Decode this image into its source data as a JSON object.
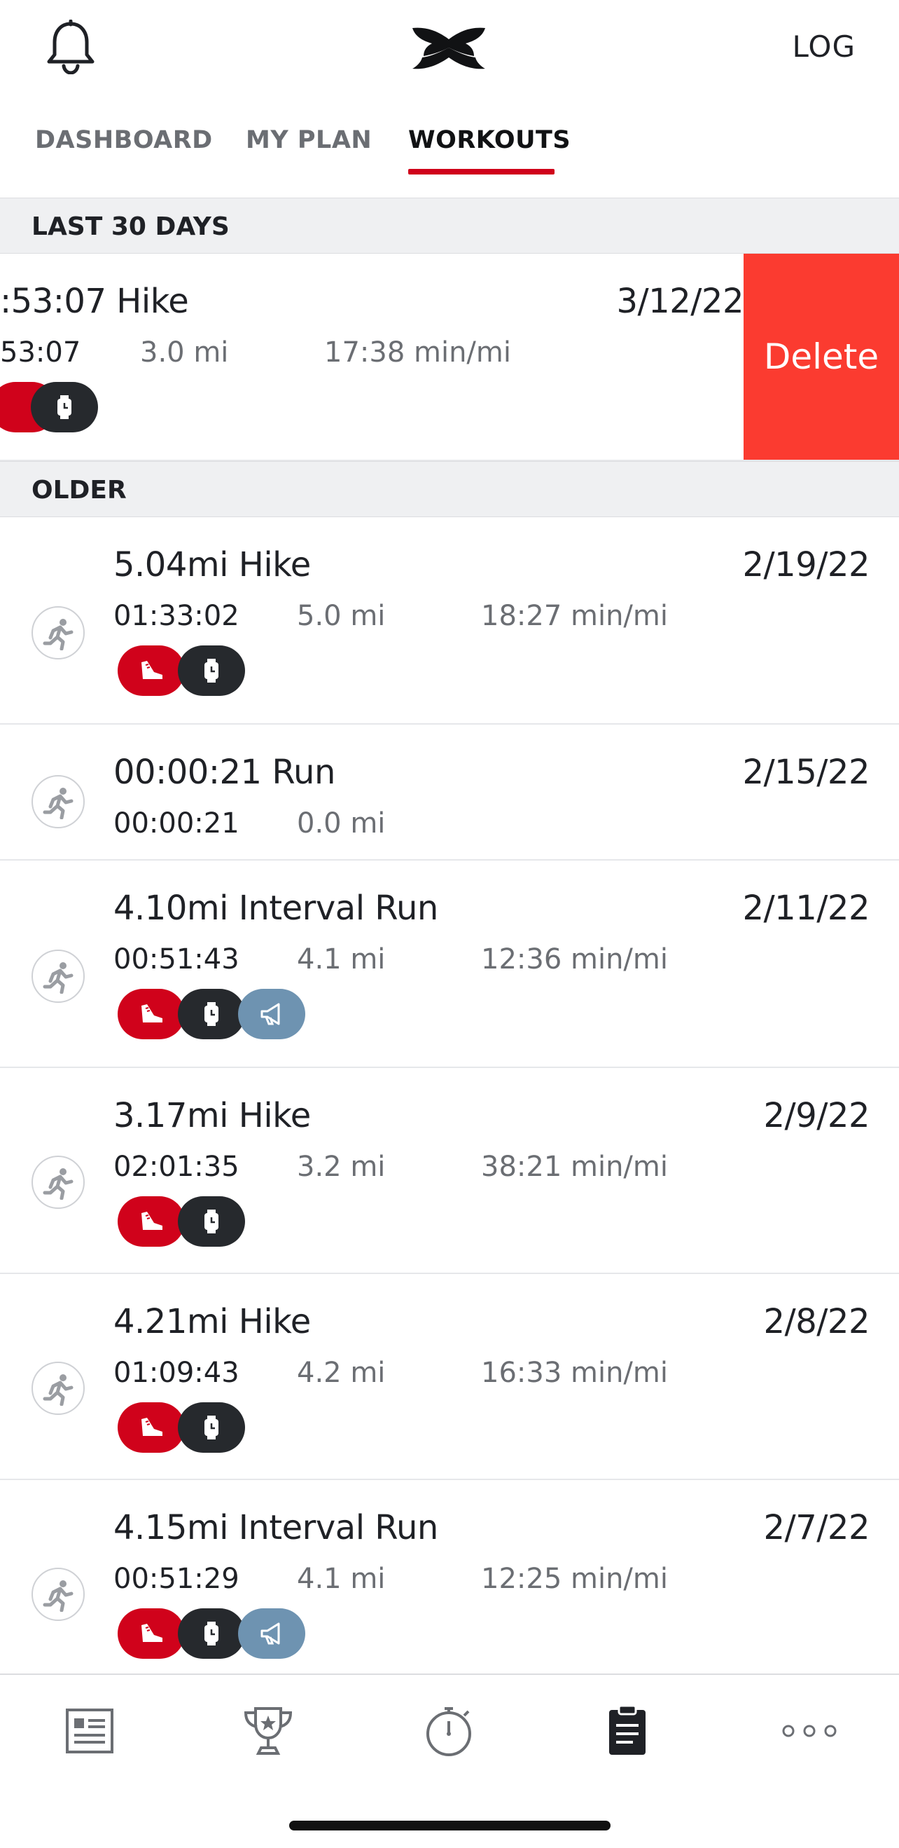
{
  "header": {
    "log_label": "LOG",
    "brand_icon": "under-armour-logo",
    "notifications_icon": "bell-icon"
  },
  "tabs": [
    {
      "label": "DASHBOARD",
      "active": false
    },
    {
      "label": "MY PLAN",
      "active": false
    },
    {
      "label": "WORKOUTS",
      "active": true
    }
  ],
  "sections": {
    "recent": "LAST 30 DAYS",
    "older": "OLDER"
  },
  "swiped_workout": {
    "title": ":53:07 Hike",
    "date": "3/12/22",
    "duration": "53:07",
    "distance": "3.0 mi",
    "pace": "17:38 min/mi",
    "delete_label": "Delete"
  },
  "workouts": [
    {
      "title": "5.04mi Hike",
      "date": "2/19/22",
      "duration": "01:33:02",
      "distance": "5.0 mi",
      "pace": "18:27 min/mi",
      "badges": [
        "shoe-icon",
        "watch-icon"
      ]
    },
    {
      "title": "00:00:21 Run",
      "date": "2/15/22",
      "duration": "00:00:21",
      "distance": "0.0 mi",
      "pace": "",
      "badges": []
    },
    {
      "title": "4.10mi Interval Run",
      "date": "2/11/22",
      "duration": "00:51:43",
      "distance": "4.1 mi",
      "pace": "12:36 min/mi",
      "badges": [
        "shoe-icon",
        "watch-icon",
        "megaphone-icon"
      ]
    },
    {
      "title": "3.17mi Hike",
      "date": "2/9/22",
      "duration": "02:01:35",
      "distance": "3.2 mi",
      "pace": "38:21 min/mi",
      "badges": [
        "shoe-icon",
        "watch-icon"
      ]
    },
    {
      "title": "4.21mi Hike",
      "date": "2/8/22",
      "duration": "01:09:43",
      "distance": "4.2 mi",
      "pace": "16:33 min/mi",
      "badges": [
        "shoe-icon",
        "watch-icon"
      ]
    },
    {
      "title": "4.15mi Interval Run",
      "date": "2/7/22",
      "duration": "00:51:29",
      "distance": "4.1 mi",
      "pace": "12:25 min/mi",
      "badges": [
        "shoe-icon",
        "watch-icon",
        "megaphone-icon"
      ]
    }
  ],
  "bottom_nav": [
    {
      "icon": "feed-icon",
      "active": false
    },
    {
      "icon": "trophy-icon",
      "active": false
    },
    {
      "icon": "stopwatch-icon",
      "active": false
    },
    {
      "icon": "clipboard-icon",
      "active": true
    },
    {
      "icon": "more-icon",
      "active": false
    }
  ],
  "colors": {
    "accent_red": "#d0021b",
    "delete_red": "#fb3b30",
    "watch_badge": "#26292d",
    "promo_badge": "#6e93b1",
    "section_bg": "#eff0f2"
  }
}
